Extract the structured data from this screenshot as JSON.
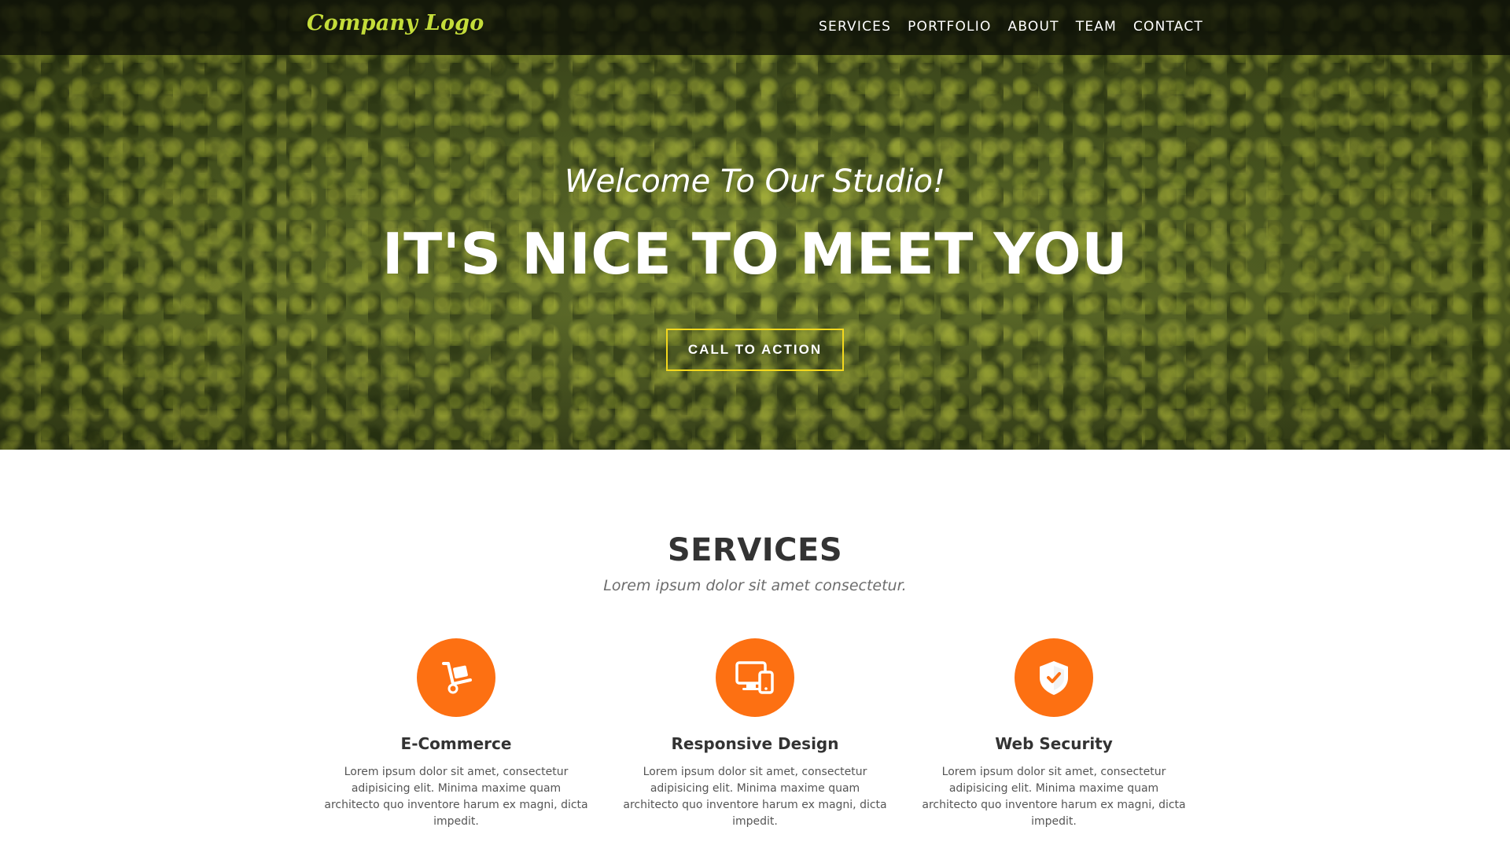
{
  "navbar": {
    "logo": "Company Logo",
    "links": [
      "SERVICES",
      "PORTFOLIO",
      "ABOUT",
      "TEAM",
      "CONTACT"
    ]
  },
  "hero": {
    "subtitle": "Welcome To Our Studio!",
    "title": "IT'S NICE TO MEET YOU",
    "cta_label": "CALL TO ACTION"
  },
  "services": {
    "title": "SERVICES",
    "subtitle": "Lorem ipsum dolor sit amet consectetur.",
    "items": [
      {
        "icon": "hand-truck-icon",
        "name": "E-Commerce",
        "description": "Lorem ipsum dolor sit amet, consectetur adipisicing elit. Minima maxime quam architecto quo inventore harum ex magni, dicta impedit."
      },
      {
        "icon": "devices-icon",
        "name": "Responsive Design",
        "description": "Lorem ipsum dolor sit amet, consectetur adipisicing elit. Minima maxime quam architecto quo inventore harum ex magni, dicta impedit."
      },
      {
        "icon": "shield-check-icon",
        "name": "Web Security",
        "description": "Lorem ipsum dolor sit amet, consectetur adipisicing elit. Minima maxime quam architecto quo inventore harum ex magni, dicta impedit."
      }
    ]
  },
  "colors": {
    "accent": "#fd7012",
    "logo": "#c4dd3a",
    "cta_border": "#f3d81d",
    "heading": "#333333"
  }
}
